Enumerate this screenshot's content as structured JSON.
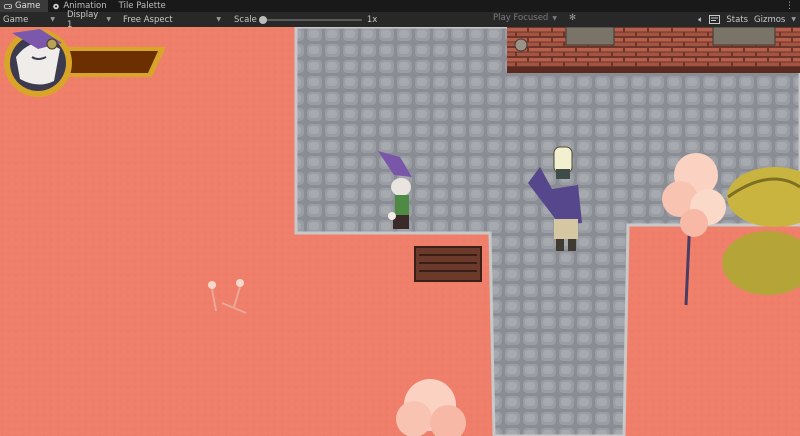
{
  "tabs": [
    {
      "label": "Game",
      "icon": "gamepad-icon",
      "active": true
    },
    {
      "label": "Animation",
      "icon": "animation-icon",
      "active": false
    },
    {
      "label": "Tile Palette",
      "icon": "",
      "active": false
    }
  ],
  "toolbar": {
    "display_mode": "Game",
    "display": "Display 1",
    "aspect": "Free Aspect",
    "scale_label": "Scale",
    "scale_value": "1x",
    "scale_fraction": 0.0,
    "play_mode": "Play Focused",
    "stats_label": "Stats",
    "gizmos_label": "Gizmos"
  },
  "colors": {
    "ground": "#ef7f6a",
    "stone": "#8c8f95",
    "brick": "#a85a4a",
    "hud_bar_fill": "#6b2f00",
    "hud_frame": "#d8a52a"
  },
  "hud": {
    "portrait": "fox-character-portrait",
    "health_fraction": 1.0
  }
}
